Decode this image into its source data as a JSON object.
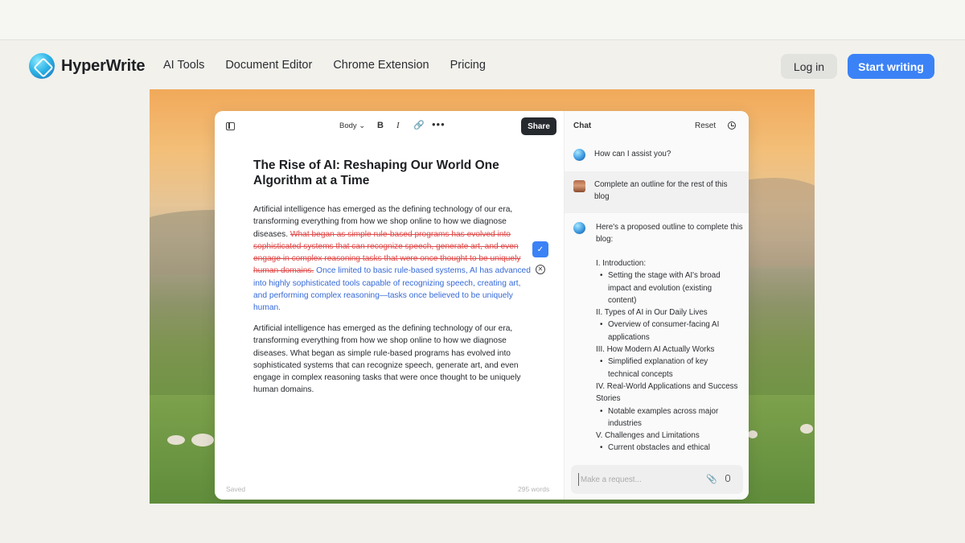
{
  "nav": {
    "brand": "HyperWrite",
    "links": [
      "AI Tools",
      "Document Editor",
      "Chrome Extension",
      "Pricing"
    ],
    "login": "Log in",
    "start": "Start writing",
    "accent_color": "#3b82f6"
  },
  "editor": {
    "style_select": "Body ⌄",
    "bold": "B",
    "italic": "I",
    "link": "🔗",
    "more": "•••",
    "share": "Share",
    "title": "The Rise of AI: Reshaping Our World One Algorithm at a Time",
    "p1_plain": "Artificial intelligence has emerged as the defining technology of our era, transforming everything from how we shop online to how we diagnose diseases. ",
    "p1_deleted": "What began as simple rule-based programs has evolved into sophisticated systems that can recognize speech, generate art, and even engage in complex reasoning tasks that were once thought to be uniquely human domains.",
    "p1_inserted": " Once limited to basic rule-based systems, AI has advanced into highly sophisticated tools capable of recognizing speech, creating art, and performing complex reasoning—tasks once believed to be uniquely human.",
    "p2": "Artificial intelligence has emerged as the defining technology of our era, transforming everything from how we shop online to how we diagnose diseases. What began as simple rule-based programs has evolved into sophisticated systems that can recognize speech, generate art, and even engage in complex reasoning tasks that were once thought to be uniquely human domains.",
    "accept": "✓",
    "reject": "✕",
    "status": "Saved",
    "word_count": "295 words"
  },
  "chat": {
    "title": "Chat",
    "reset": "Reset",
    "greeting": "How can I assist you?",
    "user_msg": "Complete an outline for the rest of this blog",
    "reply_intro": "Here's a proposed outline to complete this blog:",
    "outline": [
      {
        "kind": "sec",
        "text": "I. Introduction:"
      },
      {
        "kind": "bul",
        "text": "Setting the stage with AI's broad impact and evolution (existing content)"
      },
      {
        "kind": "sec",
        "text": "II. Types of AI in Our Daily Lives"
      },
      {
        "kind": "bul",
        "text": "Overview of consumer-facing AI applications"
      },
      {
        "kind": "sec",
        "text": "III. How Modern AI Actually Works"
      },
      {
        "kind": "bul",
        "text": "Simplified explanation of key technical concepts"
      },
      {
        "kind": "sec",
        "text": "IV. Real-World Applications and Success Stories"
      },
      {
        "kind": "bul",
        "text": "Notable examples across major industries"
      },
      {
        "kind": "sec",
        "text": "V. Challenges and Limitations"
      },
      {
        "kind": "bul",
        "text": "Current obstacles and ethical"
      }
    ],
    "input_placeholder": "Make a request...",
    "attach_icon": "📎"
  }
}
